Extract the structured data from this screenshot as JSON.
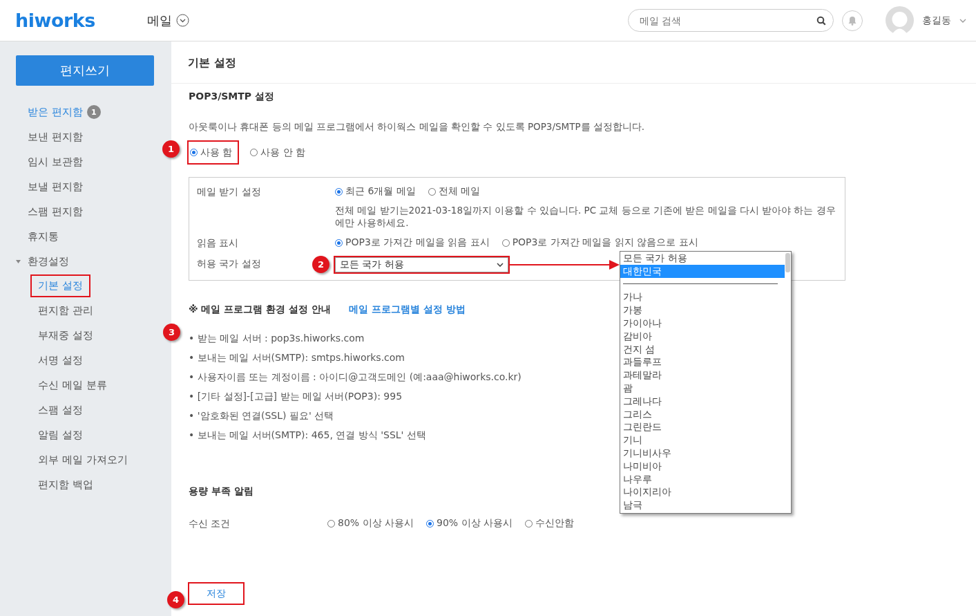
{
  "header": {
    "logo": "hiworks",
    "app_menu": "메일",
    "search": {
      "placeholder": "메일 검색"
    },
    "user": {
      "name": "홍길동"
    }
  },
  "sidebar": {
    "compose_button": "편지쓰기",
    "items": [
      {
        "label": "받은 편지함",
        "unread": true,
        "badge": "1",
        "selected": false
      },
      {
        "label": "보낸 편지함",
        "unread": false,
        "selected": false
      },
      {
        "label": "임시 보관함",
        "unread": false,
        "selected": false
      },
      {
        "label": "보낼 편지함",
        "unread": false,
        "selected": false
      },
      {
        "label": "스팸 편지함",
        "unread": false,
        "selected": false
      },
      {
        "label": "휴지통",
        "unread": false,
        "selected": false
      },
      {
        "label": "환경설정",
        "unread": false,
        "selected": false,
        "expanded": true,
        "children": [
          {
            "label": "기본 설정",
            "selected": true,
            "boxed": true
          },
          {
            "label": "편지함 관리",
            "selected": false,
            "boxed": false
          },
          {
            "label": "부재중 설정",
            "selected": false,
            "boxed": false
          },
          {
            "label": "서명 설정",
            "selected": false,
            "boxed": false
          },
          {
            "label": "수신 메일 분류",
            "selected": false,
            "boxed": false
          },
          {
            "label": "스팸 설정",
            "selected": false,
            "boxed": false
          },
          {
            "label": "알림 설정",
            "selected": false,
            "boxed": false
          },
          {
            "label": "외부 메일 가져오기",
            "selected": false,
            "boxed": false
          },
          {
            "label": "편지함 백업",
            "selected": false,
            "boxed": false
          }
        ]
      }
    ]
  },
  "main": {
    "title": "기본 설정",
    "pop3": {
      "heading": "POP3/SMTP 설정",
      "description": "아웃룩이나 휴대폰 등의 메일 프로그램에서 하이웍스 메일을 확인할 수 있도록 POP3/SMTP를 설정합니다.",
      "usage": {
        "callout": "1",
        "options": [
          {
            "label": "사용 함",
            "selected": true,
            "boxed": true
          },
          {
            "label": "사용 안 함",
            "selected": false,
            "boxed": false
          }
        ]
      },
      "settings": [
        {
          "kind": "radio",
          "label": "메일 받기 설정",
          "options": [
            {
              "label": "최근 6개월 메일",
              "selected": true
            },
            {
              "label": "전체 메일",
              "selected": false
            }
          ],
          "note": "전체 메일 받기는2021-03-18일까지 이용할 수 있습니다. PC 교체 등으로 기존에 받은 메일을 다시 받아야 하는 경우에만 사용하세요."
        },
        {
          "kind": "radio",
          "label": "읽음 표시",
          "options": [
            {
              "label": "POP3로 가져간 메일을 읽음 표시",
              "selected": true
            },
            {
              "label": "POP3로 가져간 메일을 읽지 않음으로 표시",
              "selected": false
            }
          ]
        },
        {
          "kind": "select",
          "label": "허용 국가 설정",
          "callout": "2",
          "boxed": true,
          "value": "모든 국가 허용",
          "dropdown": {
            "options": [
              {
                "kind": "option",
                "label": "모든 국가 허용",
                "selected": false
              },
              {
                "kind": "option",
                "label": "대한민국",
                "selected": true
              },
              {
                "kind": "separator"
              },
              {
                "kind": "option",
                "label": "가나",
                "selected": false
              },
              {
                "kind": "option",
                "label": "가봉",
                "selected": false
              },
              {
                "kind": "option",
                "label": "가이아나",
                "selected": false
              },
              {
                "kind": "option",
                "label": "감비아",
                "selected": false
              },
              {
                "kind": "option",
                "label": "건지 섬",
                "selected": false
              },
              {
                "kind": "option",
                "label": "과들루프",
                "selected": false
              },
              {
                "kind": "option",
                "label": "과테말라",
                "selected": false
              },
              {
                "kind": "option",
                "label": "괌",
                "selected": false
              },
              {
                "kind": "option",
                "label": "그레나다",
                "selected": false
              },
              {
                "kind": "option",
                "label": "그리스",
                "selected": false
              },
              {
                "kind": "option",
                "label": "그린란드",
                "selected": false
              },
              {
                "kind": "option",
                "label": "기니",
                "selected": false
              },
              {
                "kind": "option",
                "label": "기니비사우",
                "selected": false
              },
              {
                "kind": "option",
                "label": "나미비아",
                "selected": false
              },
              {
                "kind": "option",
                "label": "나우루",
                "selected": false
              },
              {
                "kind": "option",
                "label": "나이지리아",
                "selected": false
              },
              {
                "kind": "option",
                "label": "남극",
                "selected": false
              }
            ]
          }
        }
      ]
    },
    "guide": {
      "title": "※ 메일 프로그램 환경 설정 안내",
      "link": "메일 프로그램별 설정 방법",
      "callout": "3",
      "items": [
        "• 받는 메일 서버 : pop3s.hiworks.com",
        "• 보내는 메일 서버(SMTP): smtps.hiworks.com",
        "• 사용자이름 또는 계정이름 : 아이디@고객도메인 (예:aaa@hiworks.co.kr)",
        "• [기타 설정]-[고급] 받는 메일 서버(POP3): 995",
        "• '암호화된 연결(SSL) 필요' 선택",
        "• 보내는 메일 서버(SMTP): 465, 연결 방식 'SSL' 선택"
      ]
    },
    "quota": {
      "heading": "용량 부족 알림",
      "label": "수신 조건",
      "options": [
        {
          "label": "80% 이상 사용시",
          "selected": false
        },
        {
          "label": "90% 이상 사용시",
          "selected": true
        },
        {
          "label": "수신안함",
          "selected": false
        }
      ]
    },
    "save_button": {
      "label": "저장",
      "callout": "4",
      "boxed": true
    }
  }
}
